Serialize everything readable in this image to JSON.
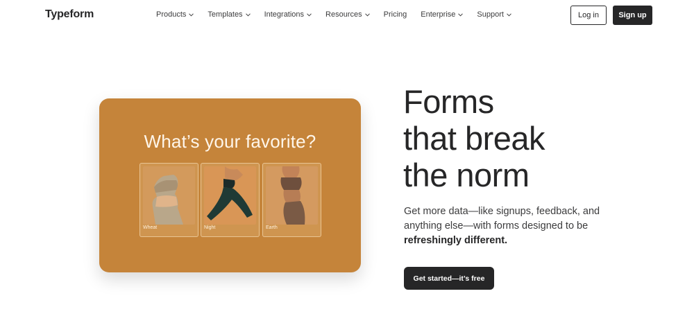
{
  "header": {
    "logo": "Typeform",
    "nav": [
      {
        "label": "Products",
        "has_dropdown": true
      },
      {
        "label": "Templates",
        "has_dropdown": true
      },
      {
        "label": "Integrations",
        "has_dropdown": true
      },
      {
        "label": "Resources",
        "has_dropdown": true
      },
      {
        "label": "Pricing",
        "has_dropdown": false
      },
      {
        "label": "Enterprise",
        "has_dropdown": true
      },
      {
        "label": "Support",
        "has_dropdown": true
      }
    ],
    "login_label": "Log in",
    "signup_label": "Sign up"
  },
  "hero": {
    "card": {
      "question": "What’s your favorite?",
      "options": [
        {
          "label": "Wheat",
          "color": "#b9a78a"
        },
        {
          "label": "Night",
          "color": "#1f3a35"
        },
        {
          "label": "Earth",
          "color": "#7a5a45"
        }
      ],
      "background_color": "#c5843a"
    },
    "headline": [
      "Forms",
      "that break",
      "the norm"
    ],
    "subtext": "Get more data—like signups, feedback, and anything else—with forms designed to be",
    "subtext_bold": "refreshingly different.",
    "cta_label": "Get started—it’s free"
  }
}
